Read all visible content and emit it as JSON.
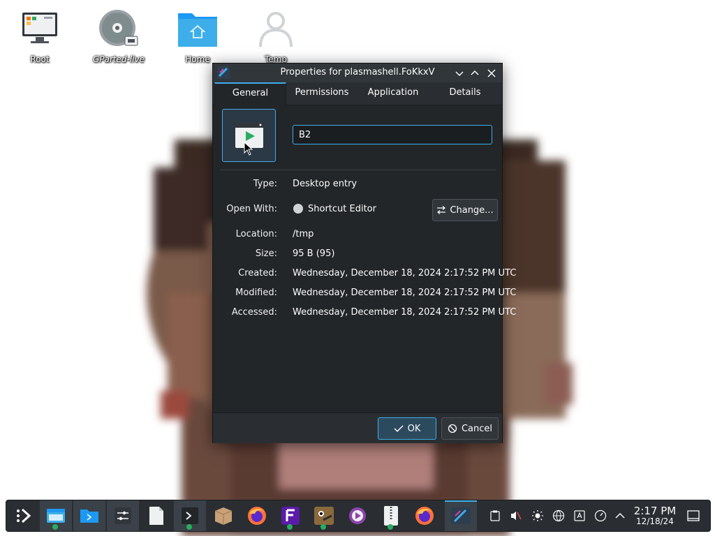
{
  "desktop": {
    "icons": [
      {
        "label": "Root",
        "icon": "monitor-icon"
      },
      {
        "label": "GParted-live",
        "icon": "disc-icon"
      },
      {
        "label": "Home",
        "icon": "home-folder-icon"
      },
      {
        "label": "Temp",
        "icon": "user-icon"
      }
    ]
  },
  "dialog": {
    "title": "Properties for plasmashell.FoKkxV",
    "tabs": [
      "General",
      "Permissions",
      "Application",
      "Details"
    ],
    "active_tab": "General",
    "name_value": "B2",
    "properties": {
      "type_label": "Type:",
      "type_value": "Desktop entry",
      "openwith_label": "Open With:",
      "openwith_value": "Shortcut Editor",
      "change_label": "Change...",
      "location_label": "Location:",
      "location_value": "/tmp",
      "size_label": "Size:",
      "size_value": "95 B (95)",
      "created_label": "Created:",
      "created_value": "Wednesday, December 18, 2024 2:17:52 PM UTC",
      "modified_label": "Modified:",
      "modified_value": "Wednesday, December 18, 2024 2:17:52 PM UTC",
      "accessed_label": "Accessed:",
      "accessed_value": "Wednesday, December 18, 2024 2:17:52 PM UTC"
    },
    "ok_label": "OK",
    "cancel_label": "Cancel"
  },
  "taskbar": {
    "clock_time": "2:17 PM",
    "clock_date": "12/18/24"
  },
  "colors": {
    "accent": "#3daee9",
    "window_bg": "#232629",
    "titlebar_bg": "#31363b"
  }
}
